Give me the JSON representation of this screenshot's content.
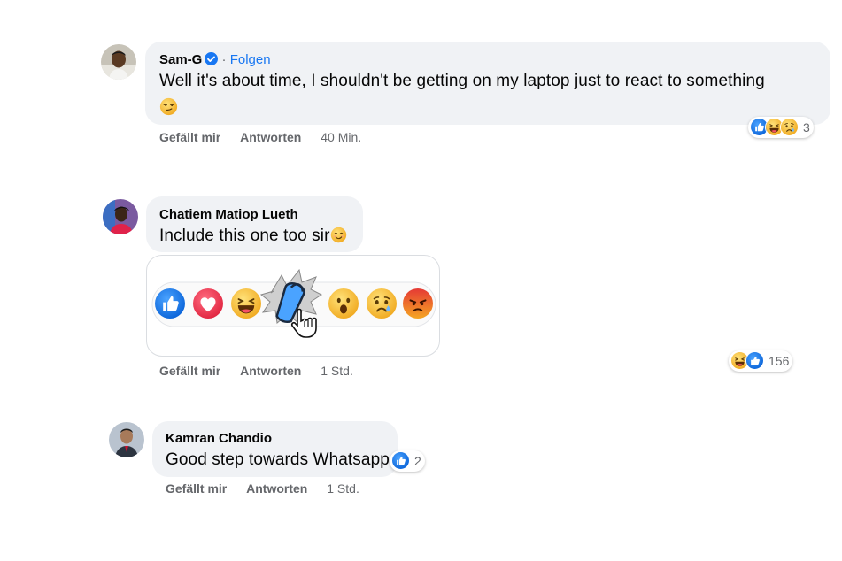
{
  "comments": [
    {
      "author": "Sam-G",
      "follow_label": "Folgen",
      "separator": "·",
      "text": "Well it's about time, I shouldn't be getting on my laptop just to react to something",
      "like_label": "Gefällt mir",
      "reply_label": "Antworten",
      "time": "40 Min.",
      "reaction_count": "3",
      "reaction_icons": [
        "like-icon",
        "haha-icon",
        "sad-icon"
      ],
      "inline_emoji": "smirk-emoji"
    },
    {
      "author": "Chatiem Matiop Lueth",
      "text": "Include this one too sir",
      "like_label": "Gefällt mir",
      "reply_label": "Antworten",
      "time": "1 Std.",
      "reaction_count": "156",
      "reaction_icons": [
        "haha-icon",
        "like-icon"
      ],
      "inline_emoji": "smile-emoji",
      "attachment_icons": [
        "like-icon",
        "love-icon",
        "haha-icon",
        "custom-icon",
        "wow-icon",
        "sad-icon",
        "angry-icon",
        "hand-cursor-icon"
      ]
    },
    {
      "author": "Kamran Chandio",
      "text": "Good step towards Whatsapp",
      "like_label": "Gefällt mir",
      "reply_label": "Antworten",
      "time": "1 Std.",
      "reaction_count": "2",
      "reaction_icons": [
        "like-icon"
      ]
    }
  ],
  "colors": {
    "bubble": "#f0f2f5",
    "link": "#1877f2",
    "secondary_text": "#65676b",
    "like": "#1877f2",
    "love": "#f33e58",
    "emoji_yellow": "#f7b125",
    "angry": "#e9710f"
  }
}
